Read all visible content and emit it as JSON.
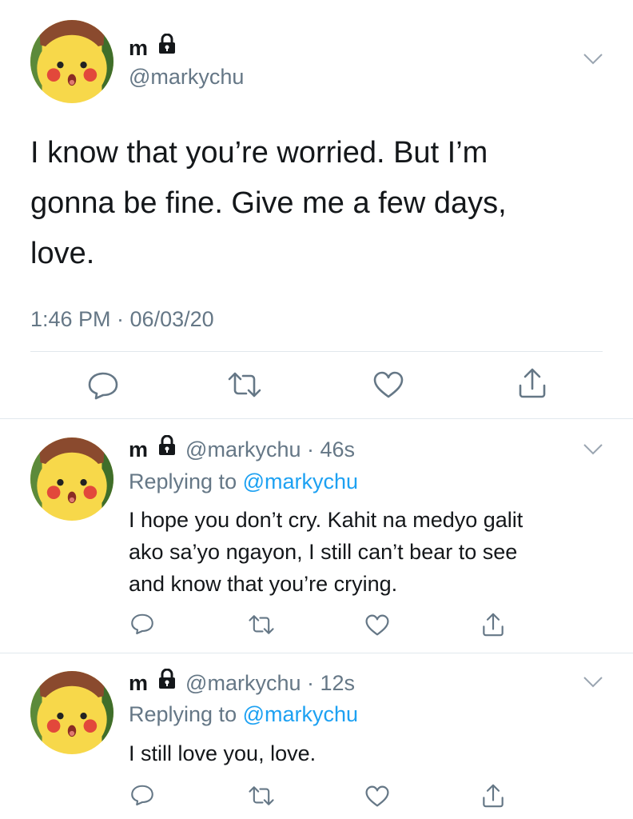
{
  "main_tweet": {
    "display_name": "m",
    "handle": "@markychu",
    "text_lines": [
      "I know that you’re worried. But I’m",
      "gonna be fine. Give me a few days,",
      "love."
    ],
    "timestamp": "1:46 PM · 06/03/20"
  },
  "replies": [
    {
      "display_name": "m",
      "handle": "@markychu",
      "time": "46s",
      "replying_prefix": "Replying to",
      "replying_handle": "@markychu",
      "text_lines": [
        "I hope you don’t cry. Kahit na medyo galit",
        "ako sa’yo ngayon, I still can’t bear to see",
        "and know that you’re crying."
      ]
    },
    {
      "display_name": "m",
      "handle": "@markychu",
      "time": "12s",
      "replying_prefix": "Replying to",
      "replying_handle": "@markychu",
      "text_lines": [
        "I still love you, love."
      ]
    }
  ],
  "icons": [
    "lock-icon",
    "chevron-down-icon",
    "reply-icon",
    "retweet-icon",
    "like-icon",
    "share-icon"
  ],
  "colors": {
    "text": "#14171a",
    "secondary": "#657786",
    "link": "#1da1f2",
    "divider": "#e1e8ed",
    "icon": "#657786"
  }
}
